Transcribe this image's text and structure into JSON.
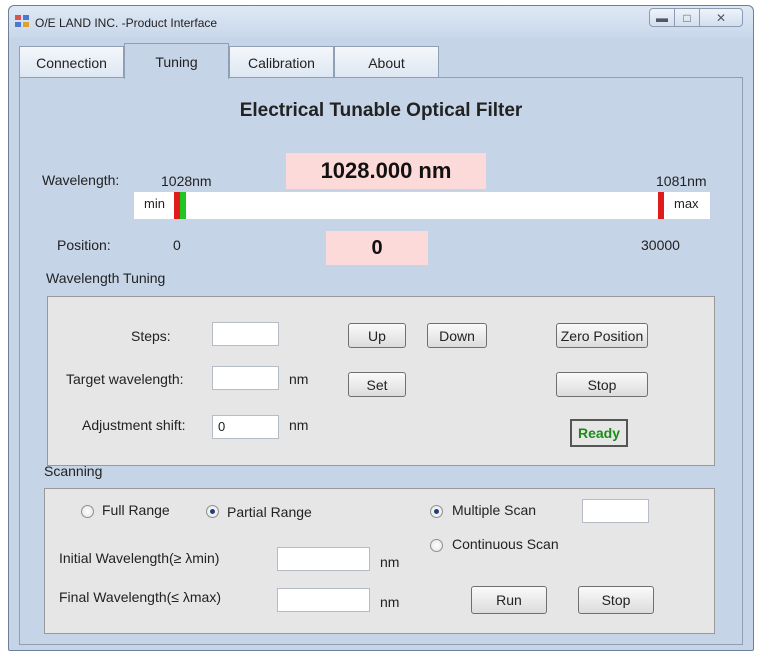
{
  "window": {
    "title": "O/E LAND INC. -Product Interface",
    "controls": [
      "minimize-icon",
      "maximize-icon",
      "close-icon"
    ]
  },
  "tabs": [
    {
      "label": "Connection"
    },
    {
      "label": "Tuning"
    },
    {
      "label": "Calibration"
    },
    {
      "label": "About"
    }
  ],
  "active_tab": "Tuning",
  "header": {
    "title": "Electrical Tunable Optical Filter"
  },
  "wavelength": {
    "label": "Wavelength:",
    "min": "1028nm",
    "max": "1081nm",
    "current": "1028.000  nm"
  },
  "slider": {
    "min_label": "min",
    "max_label": "max",
    "position_fraction": 0,
    "colors": {
      "min_marker": "#e01b1b",
      "current_marker": "#22c522",
      "max_marker": "#e01b1b"
    }
  },
  "position": {
    "label": "Position:",
    "min": "0",
    "max": "30000",
    "current": "0"
  },
  "wavelength_tuning": {
    "section_label": "Wavelength Tuning",
    "steps_label": "Steps:",
    "steps_value": "",
    "target_label": "Target wavelength:",
    "target_value": "",
    "target_unit": "nm",
    "adjust_label": "Adjustment shift:",
    "adjust_value": "0",
    "adjust_unit": "nm",
    "up_button": "Up",
    "down_button": "Down",
    "set_button": "Set",
    "zero_button": "Zero Position",
    "stop_button": "Stop",
    "status": "Ready",
    "status_color": "#1c8a1c"
  },
  "scanning": {
    "section_label": "Scanning",
    "full_range_label": "Full Range",
    "partial_range_label": "Partial Range",
    "range_selected": "Partial Range",
    "multiple_scan_label": "Multiple  Scan",
    "continuous_scan_label": "Continuous  Scan",
    "scan_mode_selected": "Multiple  Scan",
    "scan_count_value": "",
    "initial_label": "Initial  Wavelength(≥ λmin)",
    "initial_value": "",
    "initial_unit": "nm",
    "final_label": "Final  Wavelength(≤ λmax)",
    "final_value": "",
    "final_unit": "nm",
    "run_button": "Run",
    "stop_button": "Stop"
  }
}
